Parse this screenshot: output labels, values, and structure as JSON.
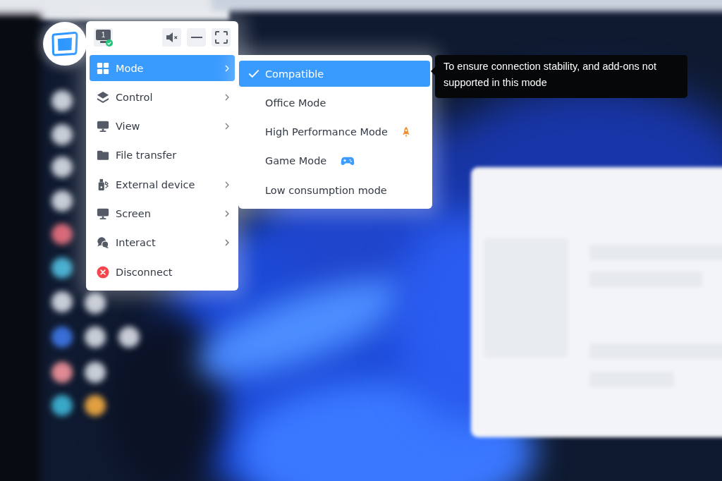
{
  "display": {
    "number": "1"
  },
  "menu": {
    "items": [
      {
        "label": "Mode",
        "selected": true,
        "has_submenu": true
      },
      {
        "label": "Control",
        "selected": false,
        "has_submenu": true
      },
      {
        "label": "View",
        "selected": false,
        "has_submenu": true
      },
      {
        "label": "File transfer",
        "selected": false,
        "has_submenu": false
      },
      {
        "label": "External device",
        "selected": false,
        "has_submenu": true
      },
      {
        "label": "Screen",
        "selected": false,
        "has_submenu": true
      },
      {
        "label": "Interact",
        "selected": false,
        "has_submenu": true
      },
      {
        "label": "Disconnect",
        "selected": false,
        "has_submenu": false
      }
    ]
  },
  "submenu": {
    "items": [
      {
        "label": "Compatible",
        "selected": true
      },
      {
        "label": "Office Mode",
        "selected": false
      },
      {
        "label": "High Performance Mode",
        "selected": false
      },
      {
        "label": "Game Mode",
        "selected": false
      },
      {
        "label": "Low consumption mode",
        "selected": false
      }
    ]
  },
  "tooltip": {
    "text": "To ensure connection stability, and add-ons not supported in this mode"
  }
}
